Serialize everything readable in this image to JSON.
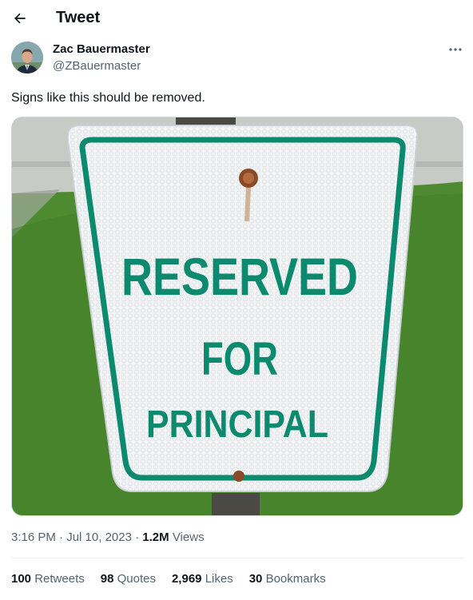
{
  "header": {
    "title": "Tweet",
    "back_icon": "arrow-left-icon"
  },
  "author": {
    "name": "Zac Bauermaster",
    "handle": "@ZBauermaster"
  },
  "tweet": {
    "text": "Signs like this should be removed."
  },
  "image": {
    "sign_lines": [
      "RESERVED",
      "FOR",
      "PRINCIPAL"
    ],
    "sign_color": "#0c8a6e"
  },
  "meta": {
    "time": "3:16 PM",
    "sep1": " · ",
    "date": "Jul 10, 2023",
    "sep2": " · ",
    "views": "1.2M",
    "views_label": " Views"
  },
  "stats": [
    {
      "count": "100",
      "label": "Retweets"
    },
    {
      "count": "98",
      "label": "Quotes"
    },
    {
      "count": "2,969",
      "label": "Likes"
    },
    {
      "count": "30",
      "label": "Bookmarks"
    }
  ],
  "colors": {
    "text": "#0f1419",
    "secondary": "#536471",
    "border": "#eff3f4"
  }
}
